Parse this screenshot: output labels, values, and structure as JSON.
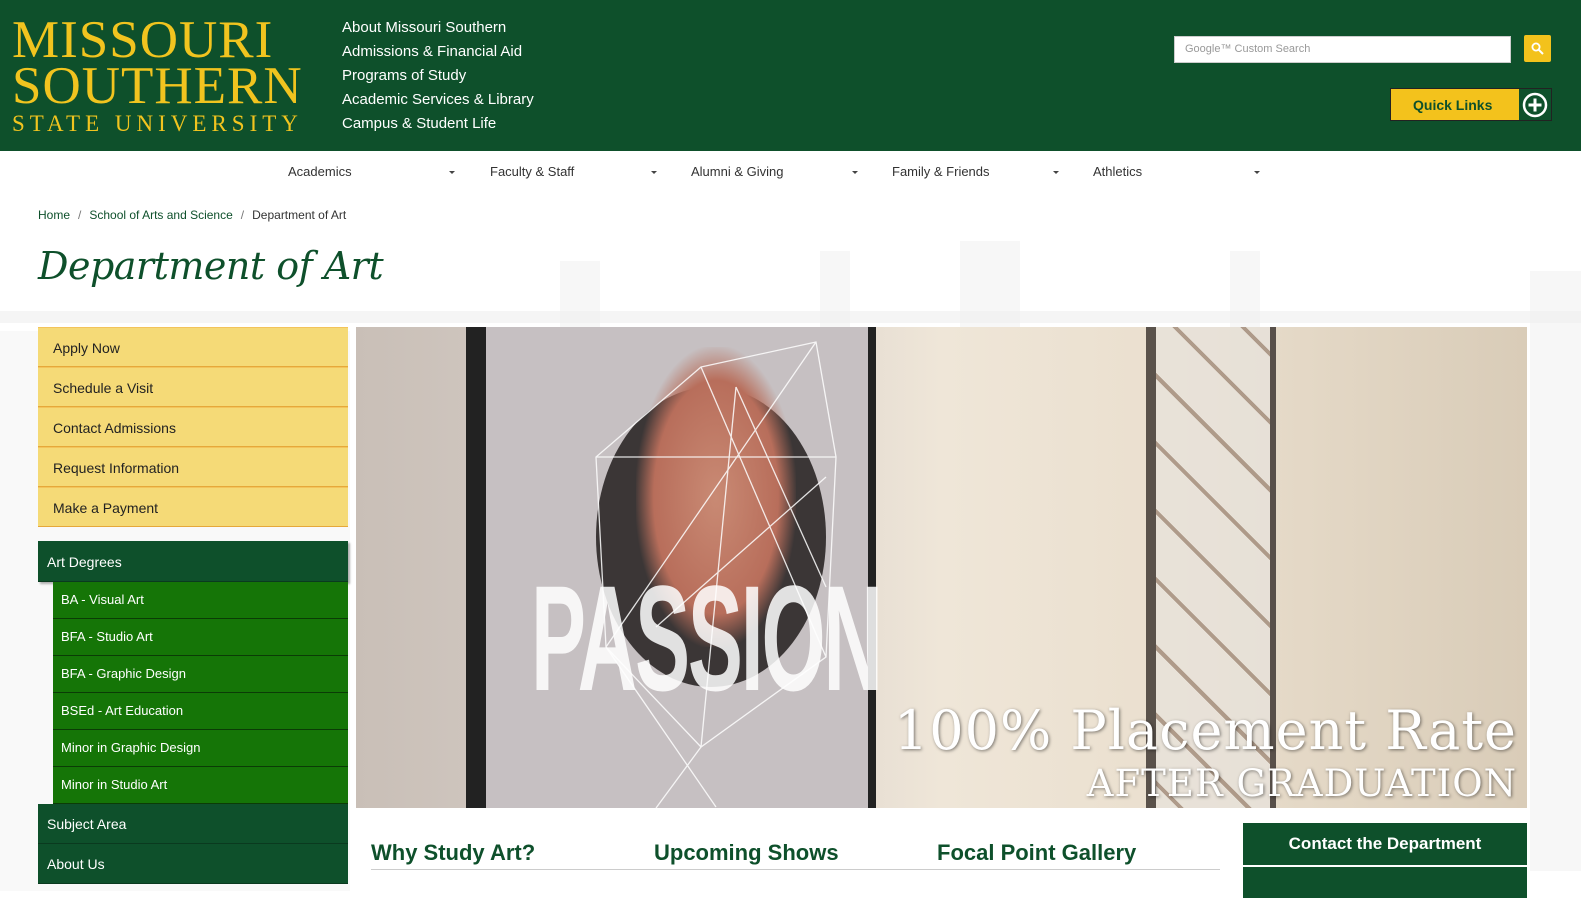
{
  "header": {
    "logo_line1": "MISSOURI",
    "logo_line2": "SOUTHERN",
    "logo_line3": "STATE UNIVERSITY",
    "top_links": [
      "About Missouri Southern",
      "Admissions & Financial Aid",
      "Programs of Study",
      "Academic Services & Library",
      "Campus & Student Life"
    ],
    "search_placeholder": "Google™ Custom Search",
    "quick_links_label": "Quick Links"
  },
  "nav": {
    "items": [
      "Academics",
      "Faculty & Staff",
      "Alumni & Giving",
      "Family & Friends",
      "Athletics"
    ]
  },
  "breadcrumb": {
    "home": "Home",
    "school": "School of Arts and Science",
    "current": "Department of Art"
  },
  "page_title": "Department of Art",
  "left_menu": {
    "actions": [
      "Apply Now",
      "Schedule a Visit",
      "Contact Admissions",
      "Request Information",
      "Make a Payment"
    ],
    "degrees_label": "Art Degrees",
    "degrees": [
      "BA - Visual Art",
      "BFA - Studio Art",
      "BFA - Graphic Design",
      "BSEd - Art Education",
      "Minor in Graphic Design",
      "Minor in Studio Art"
    ],
    "subject_area": "Subject Area",
    "about_us": "About Us"
  },
  "hero": {
    "image_text": "PASSION",
    "caption_line1": "100% Placement Rate",
    "caption_line2": "AFTER GRADUATION"
  },
  "content_tabs": [
    "Why Study Art?",
    "Upcoming Shows",
    "Focal Point Gallery"
  ],
  "sidebar": {
    "contact_title": "Contact the Department"
  },
  "colors": {
    "brand_green": "#0e502b",
    "brand_gold": "#f1c41f",
    "menu_yellow": "#f5da77",
    "degree_green": "#157507"
  }
}
